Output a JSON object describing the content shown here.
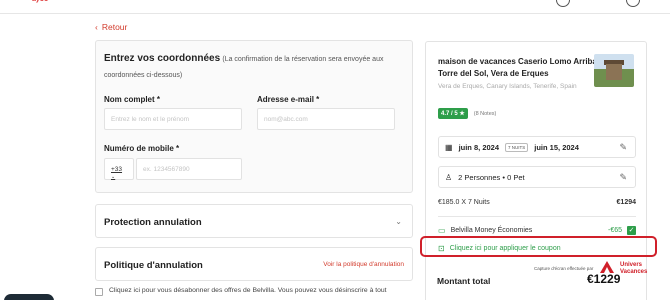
{
  "header": {
    "logo_fragment": "ayoo"
  },
  "back_link": "Retour",
  "form": {
    "title": "Entrez vos coordonnées",
    "subtitle": "(La confirmation de la réservation sera envoyée aux coordonnées ci-dessous)",
    "full_name_label": "Nom complet *",
    "full_name_placeholder": "Entrez le nom et le prénom",
    "email_label": "Adresse e-mail *",
    "email_placeholder": "nom@abc.com",
    "mobile_label": "Numéro de mobile *",
    "country_code": "+33",
    "mobile_placeholder": "ex. 1234567890"
  },
  "protection": {
    "title": "Protection annulation"
  },
  "policy": {
    "title": "Politique d'annulation",
    "link": "Voir la politique d'annulation"
  },
  "newsletter": "Cliquez ici pour vous désabonner des offres de Belvilla. Vous pouvez vous désinscrire à tout",
  "summary": {
    "property_name": "maison de vacances Caserio Lomo Arriba Torre del Sol, Vera de Erques",
    "location": "Vera de Erques, Canary Islands, Tenerife, Spain",
    "rating": "4.7 / 5 ★",
    "notes": "(8 Notes)",
    "checkin": "juin 8, 2024",
    "nights_badge": "7 NUITS",
    "checkout": "juin 15, 2024",
    "guests": "2 Personnes • 0 Pet",
    "price_label": "€185.0 X 7 Nuits",
    "price_value": "€1294",
    "savings_label": "Belvilla Money Économies",
    "savings_value": "-€65",
    "coupon": "Cliquez ici pour appliquer le coupon",
    "total_label": "Montant total",
    "total_value": "€1229"
  },
  "watermark": {
    "caption": "Capture d'écran effectuée par",
    "brand_line1": "Univers",
    "brand_line2": "Vacances"
  },
  "colors": {
    "accent_red": "#d23b2c",
    "green": "#2e9e4a",
    "highlight": "#d0202a"
  }
}
